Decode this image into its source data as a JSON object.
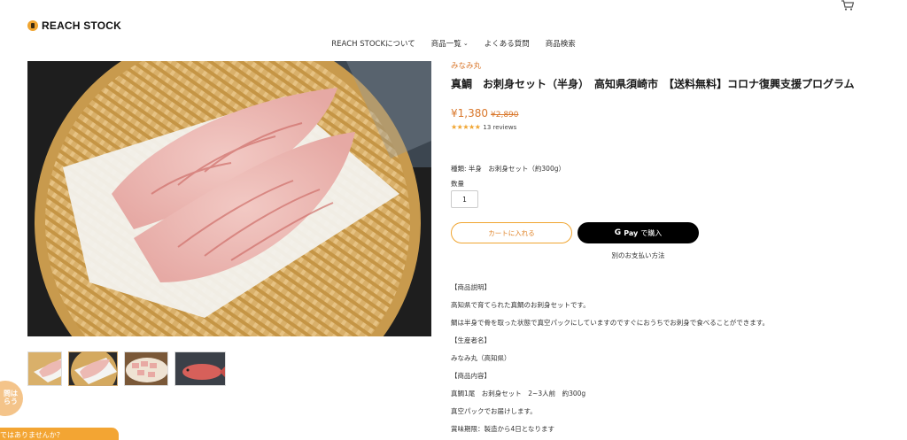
{
  "header": {
    "logo_text": "REACH STOCK",
    "nav": [
      {
        "label": "REACH STOCKについて"
      },
      {
        "label": "商品一覧"
      },
      {
        "label": "よくある質問"
      },
      {
        "label": "商品検索"
      }
    ]
  },
  "product": {
    "vendor": "みなみ丸",
    "title": "真鯛　お刺身セット（半身）　高知県須崎市　【送料無料】コロナ復興支援プログラム",
    "price": "¥1,380",
    "compare_price": "¥2,890",
    "stars": "★★★★★",
    "reviews": "13 reviews",
    "variant": "種類: 半身　お刺身セット（約300g）",
    "quantity_label": "数量",
    "quantity": "1",
    "add_to_cart": "カートに入れる",
    "gpay_label": "Pay",
    "gpay_suffix": "で購入",
    "other_payment": "別のお支払い方法",
    "description": [
      "【商品説明】",
      "高知県で育てられた真鯛のお刺身セットです。",
      "鯛は半身で骨を取った状態で真空パックにしていますのですぐにおうちでお刺身で食べることができます。",
      "【生産者名】",
      "みなみ丸（高知県）",
      "【商品内容】",
      "真鯛1尾　お刺身セット　2~3人前　約300g",
      "真空パックでお届けします。",
      "賞味期限：製造から4日となります"
    ]
  },
  "widgets": {
    "side_badge": "問は\nらう",
    "chat_text": "ではありませんか？"
  },
  "colors": {
    "accent": "#f0a531",
    "price": "#d9772b"
  }
}
